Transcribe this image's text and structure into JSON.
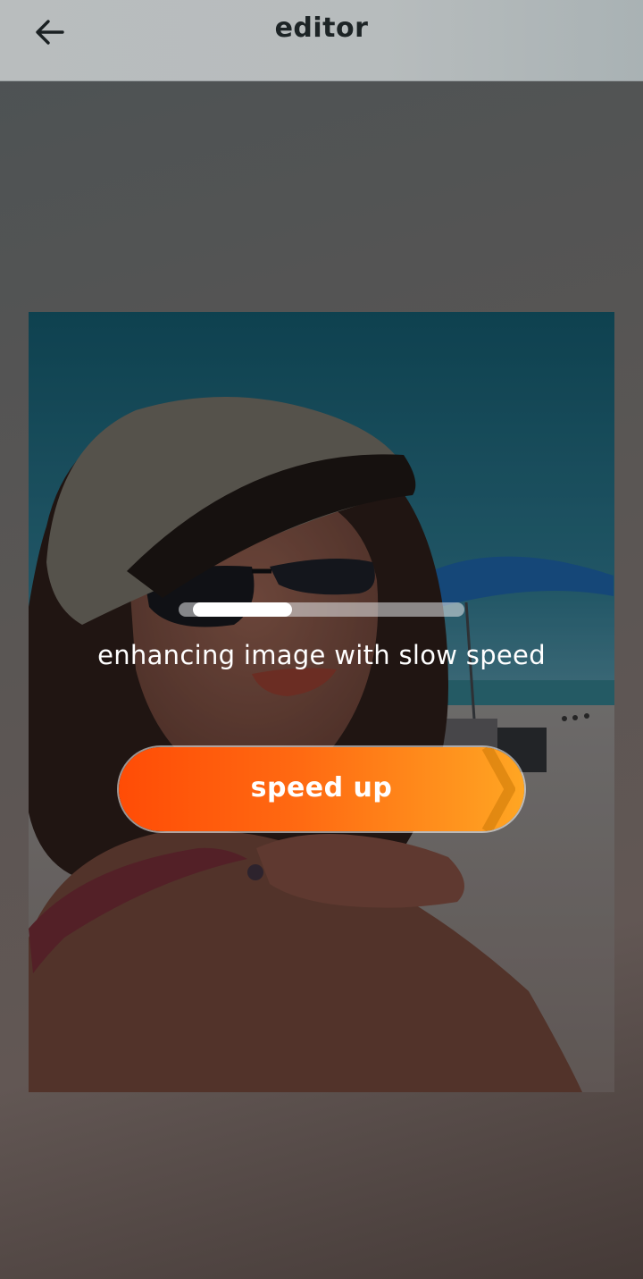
{
  "header": {
    "title": "editor",
    "back_icon": "arrow-left-icon"
  },
  "main": {
    "image_subject": "photo",
    "progress": {
      "fraction": 0.35
    },
    "status_text": "enhancing image with slow speed",
    "speed_up_label": "speed up"
  },
  "colors": {
    "header_bg": "#b8bcbd",
    "accent_start": "#ff4c06",
    "accent_end": "#ffa623",
    "text_light": "#ffffff"
  }
}
